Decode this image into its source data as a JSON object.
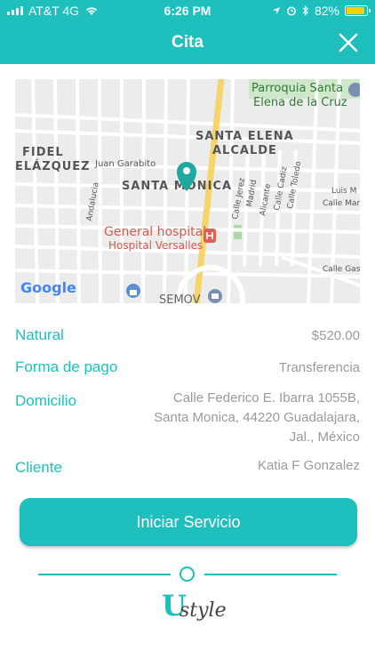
{
  "status_bar": {
    "carrier": "AT&T 4G",
    "time": "6:26 PM",
    "battery": "82%",
    "battery_level": 0.82
  },
  "nav": {
    "title": "Cita",
    "close_icon": "close-icon"
  },
  "map": {
    "labels": {
      "parroquia": "Parroquia Santa",
      "parroquia2": "Elena de la Cruz",
      "santa_elena": "SANTA ELENA",
      "alcalde": "ALCALDE",
      "fidel": "FIDEL",
      "velazquez": "ELÁZQUEZ",
      "juan_garabito": "Juan Garabito",
      "santa_monica": "SANTA MONICA",
      "andalucia": "Andalucia",
      "calle_jerez": "Calle Jerez",
      "madrid": "Madrid",
      "alicante": "Alicante",
      "calle_cadiz": "Calle Cadiz",
      "calle_toledo": "Calle Toledo",
      "luis_m": "Luis M",
      "calle_mar": "Calle Mar",
      "general_hospital": "General hospital",
      "hospital_versalles": "Hospital Versalles",
      "calle_gas": "Calle Gas",
      "semov": "SEMOV",
      "google": "Google"
    }
  },
  "details": {
    "service_label": "Natural",
    "service_value": "$520.00",
    "payment_label": "Forma de pago",
    "payment_value": "Transferencia",
    "address_label": "Domicilio",
    "address_line1": "Calle Federico E. Ibarra 1055B,",
    "address_line2": "Santa Monica, 44220 Guadalajara,",
    "address_line3": "Jal., México",
    "client_label": "Cliente",
    "client_value": "Katia F Gonzalez"
  },
  "actions": {
    "start_label": "Iniciar Servicio"
  },
  "brand": {
    "logo_u": "U",
    "logo_style": "style",
    "accent": "#1fbfbd"
  }
}
